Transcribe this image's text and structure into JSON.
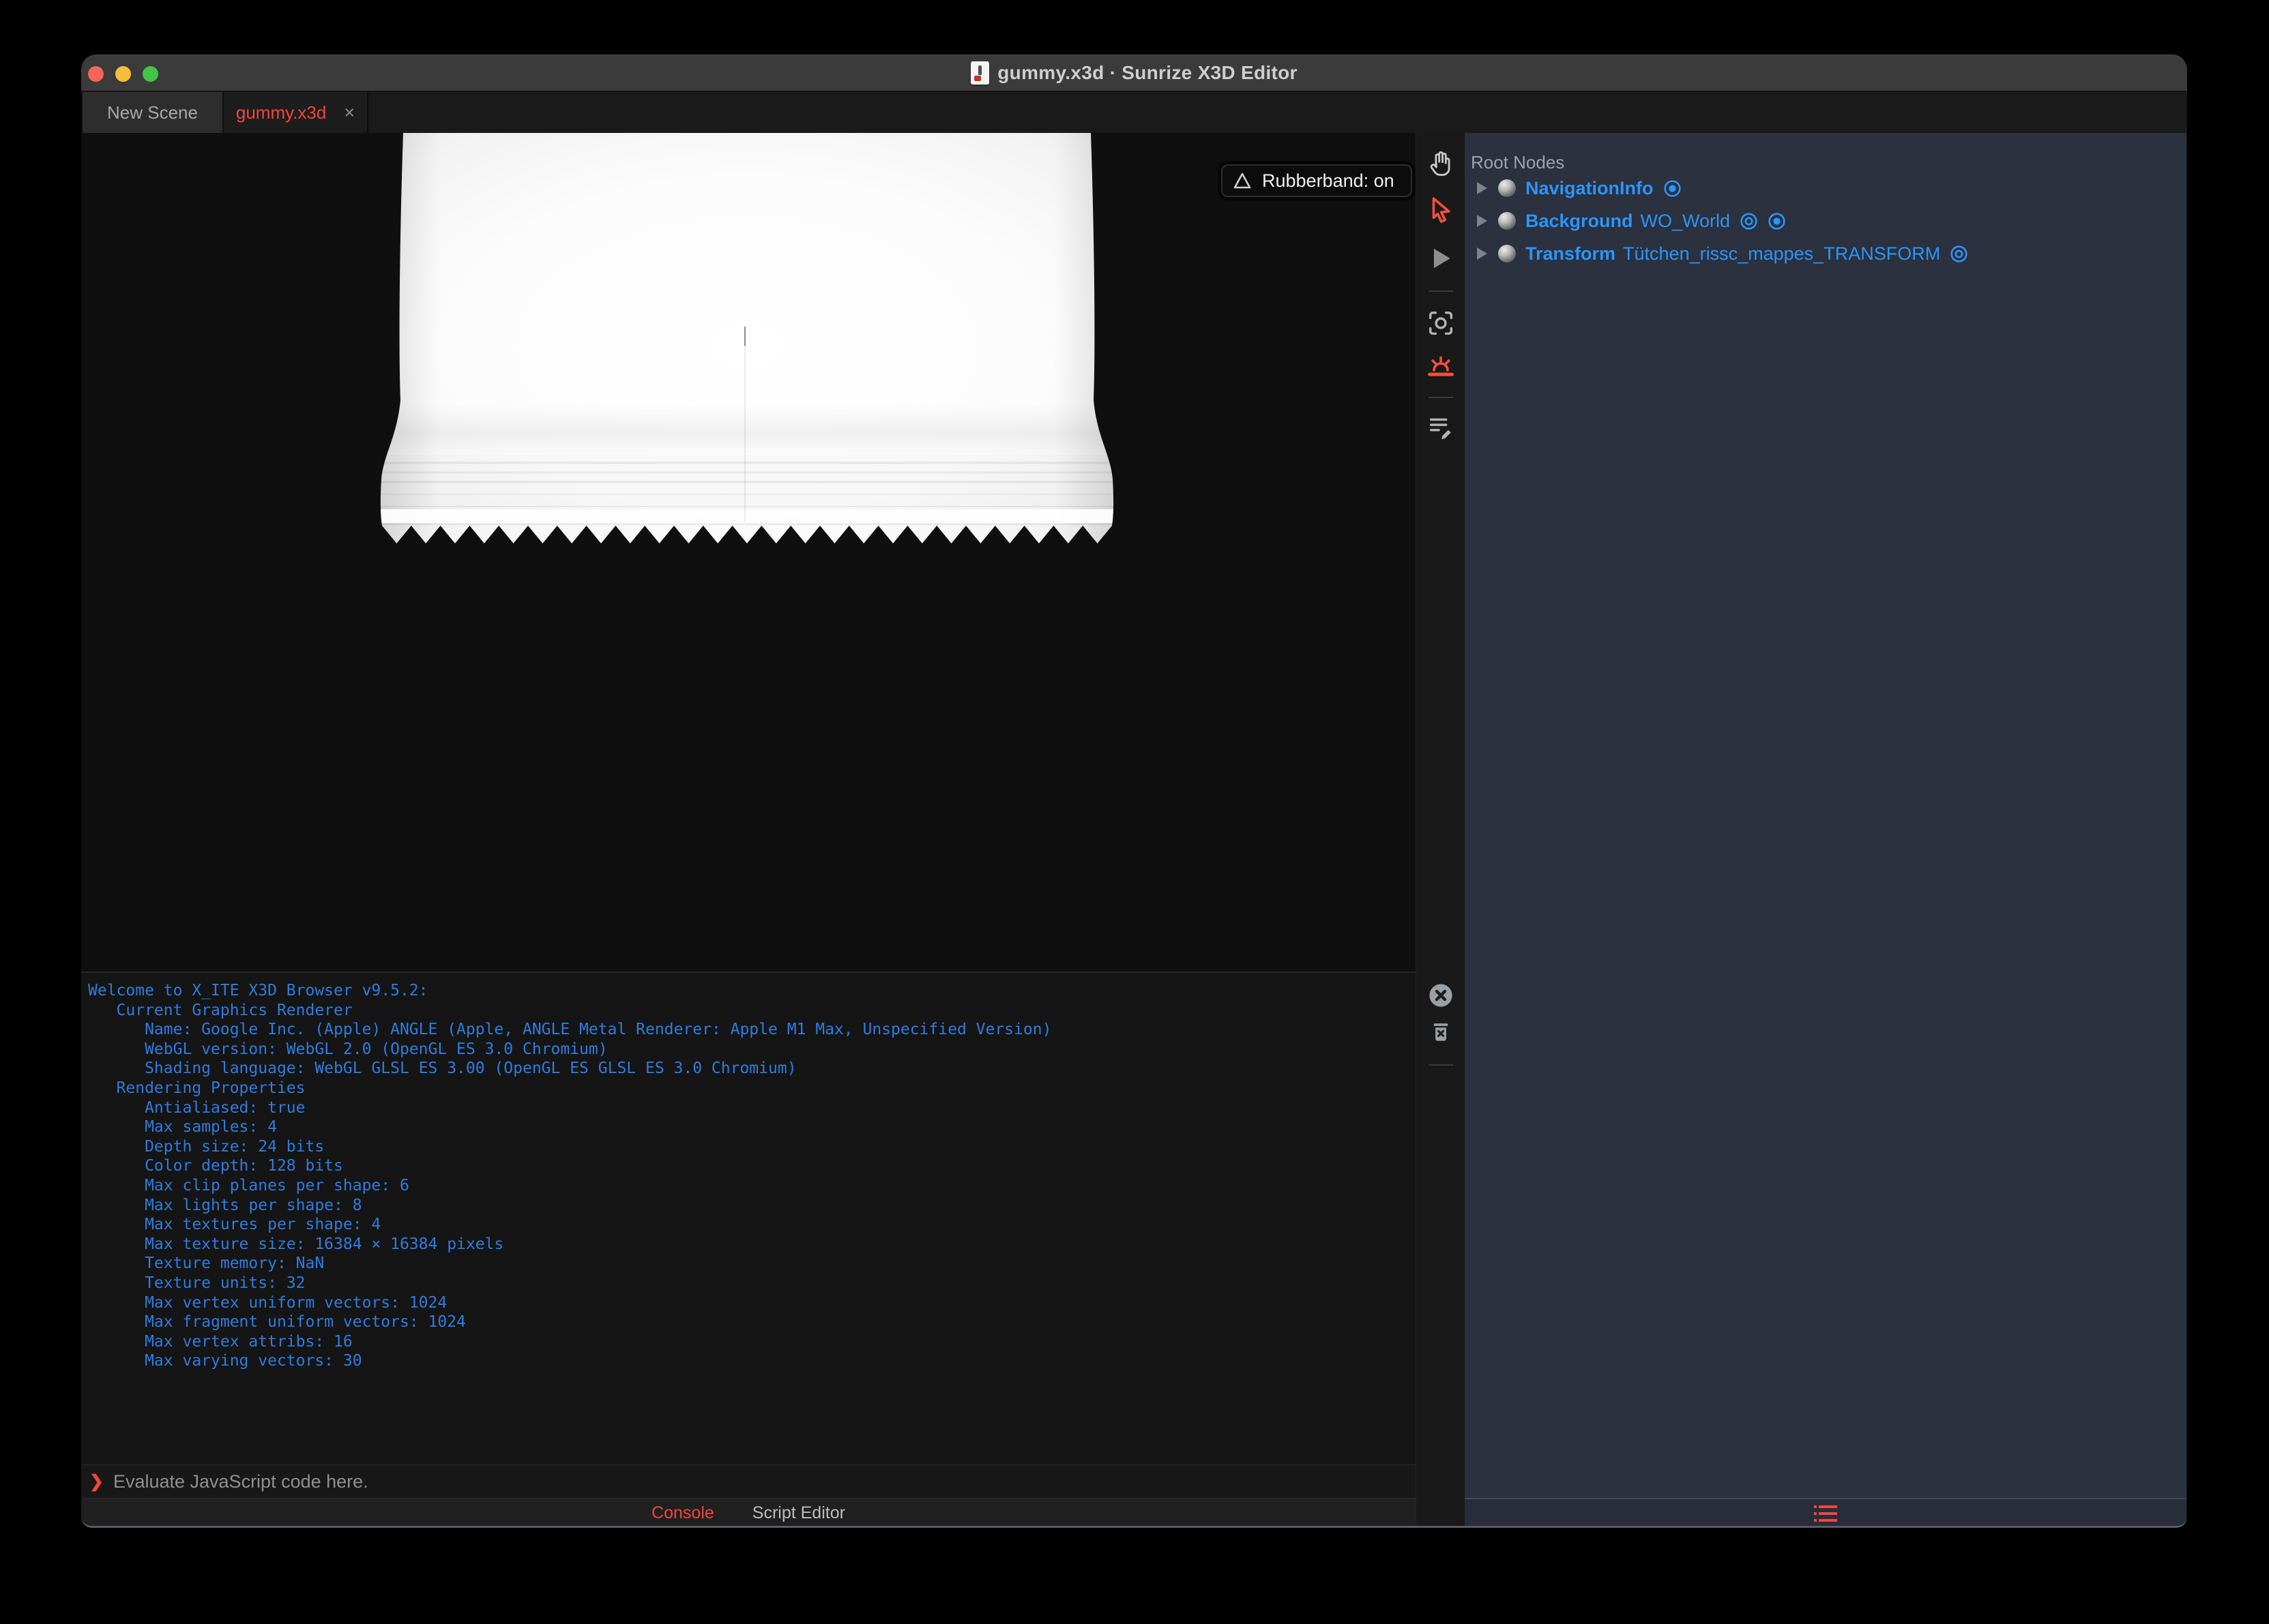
{
  "window": {
    "title": "gummy.x3d · Sunrize X3D Editor",
    "traffic_lights": {
      "close": "#f5655b",
      "minimize": "#f6bd3b",
      "zoom": "#43c645"
    }
  },
  "tabs": [
    {
      "label": "New Scene",
      "active": false
    },
    {
      "label": "gummy.x3d",
      "active": true,
      "close_glyph": "×"
    }
  ],
  "viewport": {
    "tooltip": {
      "icon": "rubberband-triangle",
      "label": "Rubberband: on"
    }
  },
  "toolbar": {
    "buttons": [
      "hand-tool",
      "select-arrow-tool",
      "play",
      "center-view",
      "sunrise-light",
      "script-edit"
    ],
    "console_buttons": [
      "clear-console",
      "delete-messages"
    ]
  },
  "outline": {
    "header": "Root Nodes",
    "nodes": [
      {
        "type": "NavigationInfo",
        "name": "",
        "icons": [
          "bound"
        ]
      },
      {
        "type": "Background",
        "name": "WO_World",
        "icons": [
          "visibility",
          "bound"
        ]
      },
      {
        "type": "Transform",
        "name": "Tütchen_rissc_mappes_TRANSFORM",
        "icons": [
          "visibility"
        ]
      }
    ]
  },
  "console": {
    "lines": [
      "Welcome to X_ITE X3D Browser v9.5.2:",
      "   Current Graphics Renderer",
      "      Name: Google Inc. (Apple) ANGLE (Apple, ANGLE Metal Renderer: Apple M1 Max, Unspecified Version)",
      "      WebGL version: WebGL 2.0 (OpenGL ES 3.0 Chromium)",
      "      Shading language: WebGL GLSL ES 3.00 (OpenGL ES GLSL ES 3.0 Chromium)",
      "   Rendering Properties",
      "      Antialiased: true",
      "      Max samples: 4",
      "      Depth size: 24 bits",
      "      Color depth: 128 bits",
      "      Max clip planes per shape: 6",
      "      Max lights per shape: 8",
      "      Max textures per shape: 4",
      "      Max texture size: 16384 × 16384 pixels",
      "      Texture memory: NaN",
      "      Texture units: 32",
      "      Max vertex uniform vectors: 1024",
      "      Max fragment uniform vectors: 1024",
      "      Max vertex attribs: 16",
      "      Max varying vectors: 30"
    ],
    "prompt_symbol": "❯",
    "prompt_placeholder": "Evaluate JavaScript code here."
  },
  "footer": {
    "tabs": [
      {
        "label": "Console",
        "active": true
      },
      {
        "label": "Script Editor",
        "active": false
      }
    ]
  },
  "colors": {
    "accent_red": "#f3453c",
    "console_blue": "#2d7ce0",
    "tree_blue": "#2b95fa",
    "panel_bg": "#2b313e",
    "titlebar_bg": "#3b3b3b"
  }
}
